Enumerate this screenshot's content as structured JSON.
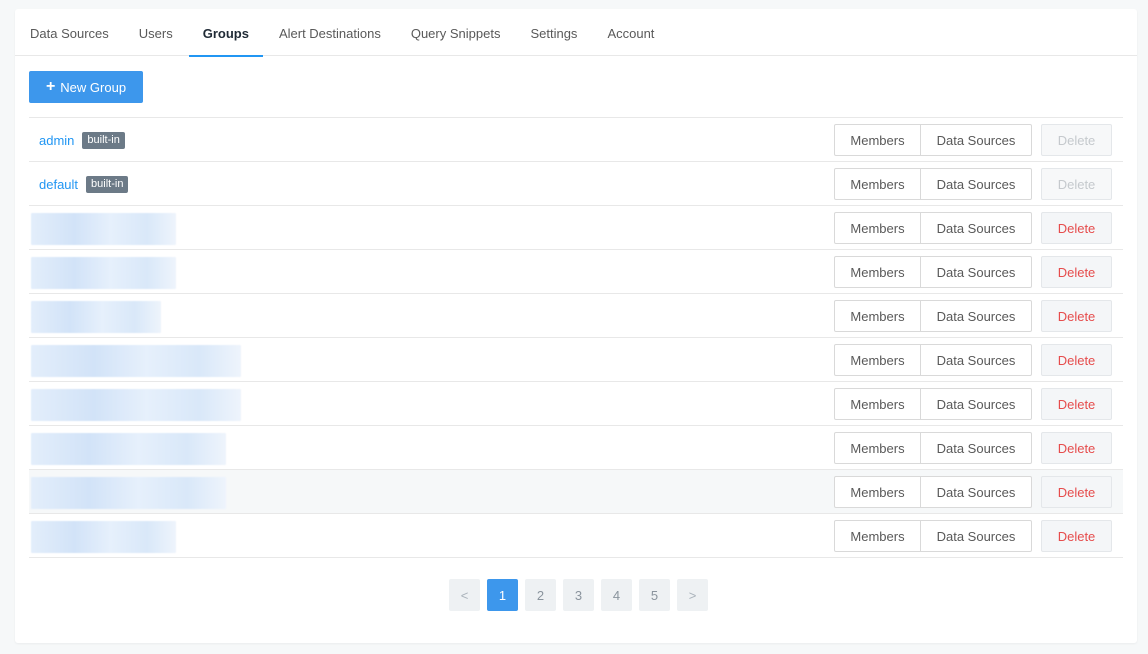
{
  "tabs": [
    "Data Sources",
    "Users",
    "Groups",
    "Alert Destinations",
    "Query Snippets",
    "Settings",
    "Account"
  ],
  "active_tab": "Groups",
  "new_group_label": "New Group",
  "new_group_icon": "plus-icon",
  "accent_color": "#3d97ec",
  "delete_color": "#e64c4c",
  "groups": [
    {
      "name": "admin",
      "badge": "built-in",
      "redacted": false,
      "delete_enabled": false
    },
    {
      "name": "default",
      "badge": "built-in",
      "redacted": false,
      "delete_enabled": false
    },
    {
      "name": "",
      "badge": "",
      "redacted": true,
      "delete_enabled": true
    },
    {
      "name": "",
      "badge": "",
      "redacted": true,
      "delete_enabled": true
    },
    {
      "name": "",
      "badge": "",
      "redacted": true,
      "delete_enabled": true
    },
    {
      "name": "",
      "badge": "",
      "redacted": true,
      "delete_enabled": true
    },
    {
      "name": "",
      "badge": "",
      "redacted": true,
      "delete_enabled": true
    },
    {
      "name": "",
      "badge": "",
      "redacted": true,
      "delete_enabled": true
    },
    {
      "name": "",
      "badge": "",
      "redacted": true,
      "delete_enabled": true
    },
    {
      "name": "",
      "badge": "",
      "redacted": true,
      "delete_enabled": true
    }
  ],
  "row_actions": {
    "members": "Members",
    "data_sources": "Data Sources",
    "delete": "Delete"
  },
  "pagination": {
    "prev": "<",
    "pages": [
      "1",
      "2",
      "3",
      "4",
      "5"
    ],
    "next": ">",
    "current": "1"
  }
}
